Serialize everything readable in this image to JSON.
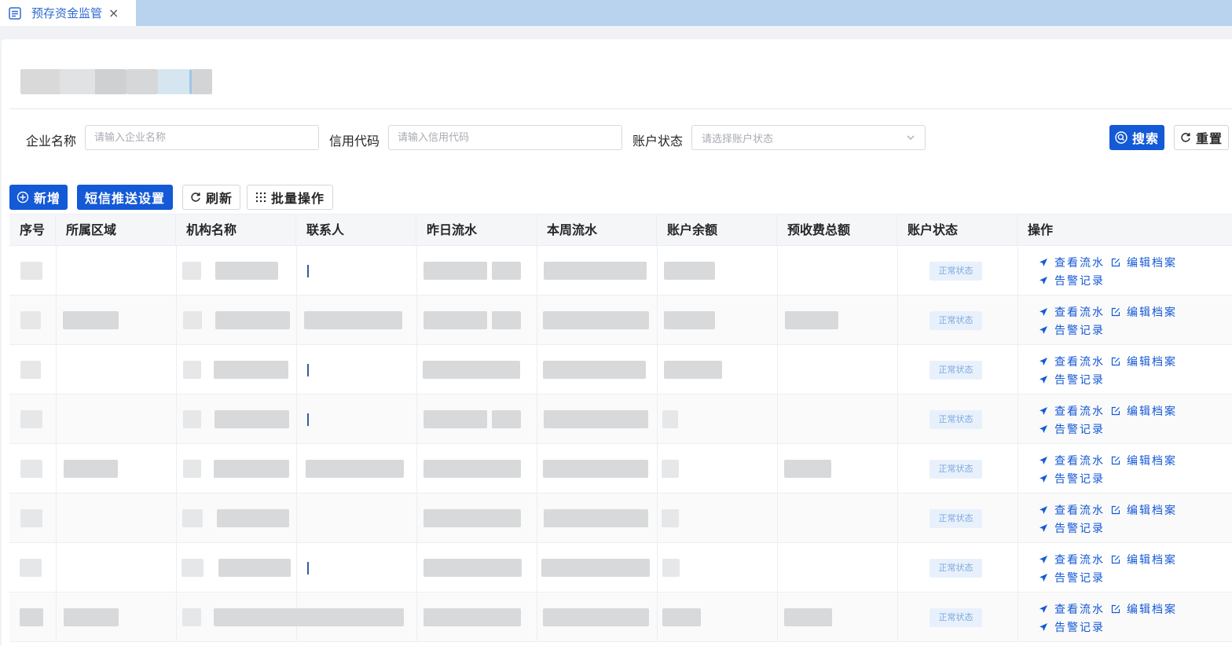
{
  "tab": {
    "title": "预存资金监管",
    "close": "×"
  },
  "search": {
    "company_label": "企业名称",
    "company_placeholder": "请输入企业名称",
    "credit_label": "信用代码",
    "credit_placeholder": "请输入信用代码",
    "status_label": "账户状态",
    "status_placeholder": "请选择账户状态",
    "search_button": "搜索",
    "reset_button": "重置"
  },
  "toolbar": {
    "add_button": "新增",
    "sms_button": "短信推送设置",
    "refresh_button": "刷新",
    "batch_button": "批量操作"
  },
  "table": {
    "columns": [
      "序号",
      "所属区域",
      "机构名称",
      "联系人",
      "昨日流水",
      "本周流水",
      "账户余额",
      "预收费总额",
      "账户状态",
      "操作"
    ],
    "rows": [
      {
        "status": "正常状态",
        "op_flow": "查看流水",
        "op_edit": "编辑档案",
        "op_alert": "告警记录"
      },
      {
        "status": "正常状态",
        "op_flow": "查看流水",
        "op_edit": "编辑档案",
        "op_alert": "告警记录"
      },
      {
        "status": "正常状态",
        "op_flow": "查看流水",
        "op_edit": "编辑档案",
        "op_alert": "告警记录"
      },
      {
        "status": "正常状态",
        "op_flow": "查看流水",
        "op_edit": "编辑档案",
        "op_alert": "告警记录"
      },
      {
        "status": "正常状态",
        "op_flow": "查看流水",
        "op_edit": "编辑档案",
        "op_alert": "告警记录"
      },
      {
        "status": "正常状态",
        "op_flow": "查看流水",
        "op_edit": "编辑档案",
        "op_alert": "告警记录"
      },
      {
        "status": "正常状态",
        "op_flow": "查看流水",
        "op_edit": "编辑档案",
        "op_alert": "告警记录"
      },
      {
        "status": "正常状态",
        "op_flow": "查看流水",
        "op_edit": "编辑档案",
        "op_alert": "告警记录"
      }
    ]
  },
  "colors": {
    "primary": "#1459d6",
    "tabbar": "#b9d3ee",
    "status_bg": "#e8f1fb",
    "status_text": "#7ea9e0"
  },
  "icons": [
    "document-icon",
    "close-icon",
    "search-icon",
    "refresh-icon",
    "plus-circle-icon",
    "grid-icon",
    "chevron-down-icon",
    "send-icon",
    "edit-icon"
  ]
}
